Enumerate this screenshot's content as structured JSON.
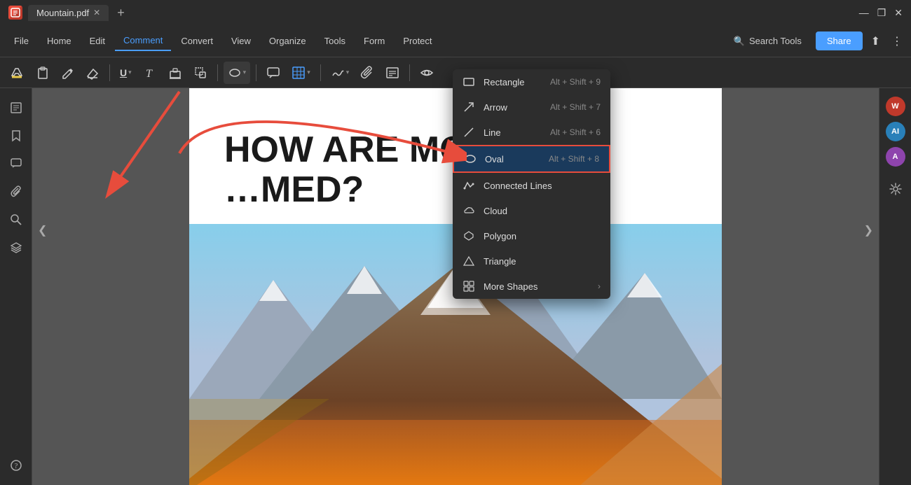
{
  "titleBar": {
    "appName": "Mountain.pdf",
    "closeBtn": "✕",
    "addBtn": "+",
    "minimizeBtn": "—",
    "maximizeBtn": "❐",
    "closeWinBtn": "✕"
  },
  "menuBar": {
    "items": [
      {
        "id": "file",
        "label": "File"
      },
      {
        "id": "home",
        "label": "Home"
      },
      {
        "id": "edit",
        "label": "Edit"
      },
      {
        "id": "comment",
        "label": "Comment",
        "active": true
      },
      {
        "id": "convert",
        "label": "Convert"
      },
      {
        "id": "view",
        "label": "View"
      },
      {
        "id": "organize",
        "label": "Organize"
      },
      {
        "id": "tools",
        "label": "Tools"
      },
      {
        "id": "form",
        "label": "Form"
      },
      {
        "id": "protect",
        "label": "Protect"
      }
    ],
    "searchPlaceholder": "Search Tools",
    "shareLabel": "Share"
  },
  "toolbar": {
    "tools": [
      "✏️",
      "📋",
      "✒️",
      "🗑️",
      "|",
      "U",
      "T",
      "⊞",
      "⧉",
      "|",
      "⬤",
      "|",
      "💬",
      "▦",
      "|",
      "✍️",
      "📎",
      "📝",
      "👁️"
    ]
  },
  "dropdown": {
    "items": [
      {
        "id": "rectangle",
        "label": "Rectangle",
        "shortcut": "Alt + Shift + 9",
        "icon": "rect"
      },
      {
        "id": "arrow",
        "label": "Arrow",
        "shortcut": "Alt + Shift + 7",
        "icon": "arrow"
      },
      {
        "id": "line",
        "label": "Line",
        "shortcut": "Alt + Shift + 6",
        "icon": "line"
      },
      {
        "id": "oval",
        "label": "Oval",
        "shortcut": "Alt + Shift + 8",
        "icon": "oval",
        "highlighted": true
      },
      {
        "id": "connected-lines",
        "label": "Connected Lines",
        "shortcut": "",
        "icon": "connected"
      },
      {
        "id": "cloud",
        "label": "Cloud",
        "shortcut": "",
        "icon": "cloud"
      },
      {
        "id": "polygon",
        "label": "Polygon",
        "shortcut": "",
        "icon": "polygon"
      },
      {
        "id": "triangle",
        "label": "Triangle",
        "shortcut": "",
        "icon": "triangle"
      },
      {
        "id": "more-shapes",
        "label": "More Shapes",
        "shortcut": "",
        "icon": "grid",
        "hasArrow": true
      }
    ]
  },
  "pdf": {
    "title": "HOW ARE MOUN…MED?"
  },
  "sidebar": {
    "icons": [
      "📄",
      "🔖",
      "💬",
      "📎",
      "🔍",
      "⊞",
      "❓"
    ]
  },
  "rightSidebar": {
    "avatars": [
      {
        "label": "W",
        "color": "#e74c3c"
      },
      {
        "label": "AI",
        "color": "#3498db"
      },
      {
        "label": "A",
        "color": "#9b59b6"
      }
    ],
    "settingsIcon": "⚙"
  },
  "navArrows": {
    "left": "❮",
    "right": "❯"
  }
}
